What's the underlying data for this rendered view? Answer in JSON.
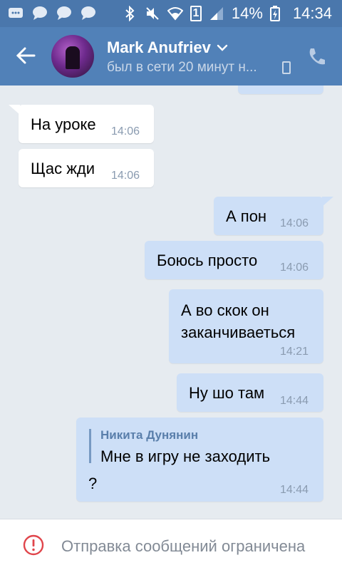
{
  "status_bar": {
    "battery": "14%",
    "time": "14:34",
    "sim": "1"
  },
  "header": {
    "name": "Mark Anufriev",
    "status": "был в сети 20 минут н..."
  },
  "messages": [
    {
      "side": "in",
      "text": "На уроке",
      "time": "14:06"
    },
    {
      "side": "in",
      "text": "Щас жди",
      "time": "14:06"
    },
    {
      "side": "out",
      "text": "А пон",
      "time": "14:06"
    },
    {
      "side": "out",
      "text": "Боюсь просто",
      "time": "14:06"
    },
    {
      "side": "out",
      "text_line1": "А во скок он",
      "text_line2": "заканчиваеться",
      "time": "14:21"
    },
    {
      "side": "out",
      "text": "Ну шо там",
      "time": "14:44"
    },
    {
      "side": "out",
      "reply_author": "Никита Дунянин",
      "reply_text": "Мне в игру не заходить",
      "text": "?",
      "time": "14:44"
    }
  ],
  "bottom_bar": {
    "text": "Отправка сообщений ограничена"
  },
  "colors": {
    "header": "#5181b8",
    "status_bar": "#4a77ac",
    "outgoing_bubble": "#cddff7",
    "incoming_bubble": "#ffffff",
    "chat_background": "#e6ebf0"
  },
  "icons": [
    "notification-icon",
    "message-icon",
    "bluetooth-icon",
    "mute-icon",
    "wifi-icon",
    "signal-icon",
    "battery-icon",
    "back-arrow-icon",
    "chevron-down-icon",
    "mobile-icon",
    "phone-icon",
    "warning-icon"
  ]
}
